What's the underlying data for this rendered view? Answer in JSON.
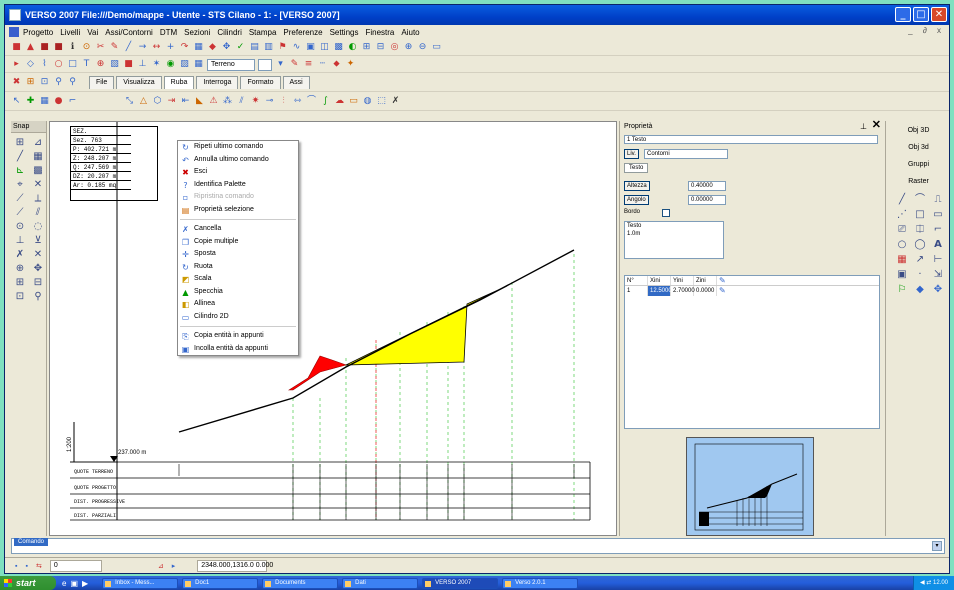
{
  "window": {
    "title": "VERSO 2007 File:///Demo/mappe - Utente - STS Cilano - 1: - [VERSO 2007]",
    "mdi_controls": "_ ∂ x"
  },
  "menu": [
    "Progetto",
    "Livelli",
    "Vai",
    "Assi/Contorni",
    "DTM",
    "Sezioni",
    "Cilindri",
    "Stampa",
    "Preferenze",
    "Settings",
    "Finestra",
    "Aiuto"
  ],
  "toolbar": {
    "layer_combo": "Terreno",
    "tabs": [
      "File",
      "Visualizza",
      "Ruba",
      "Interroga",
      "Formato",
      "Assi"
    ]
  },
  "left_panel": {
    "title": "Snap"
  },
  "info_box": {
    "lines": [
      "SEZ.",
      "Sez. 763",
      "P: 402.721 m",
      "Z: 248.207 m",
      "Q: 247.569 m",
      "DZ: 20.207 m",
      "Ar: 0.185 mq"
    ]
  },
  "drawing": {
    "ruler_label": "1:200",
    "ref_label": "237.000 m",
    "table_rows": [
      "QUOTE TERRENO",
      "QUOTE PROGETTO",
      "DIST. PROGRESSIVE",
      "DIST. PARZIALI"
    ]
  },
  "context_menu": {
    "items": [
      {
        "label": "Ripeti ultimo comando",
        "icon": "repeat-icon",
        "glyph": "↻",
        "disabled": false
      },
      {
        "label": "Annulla ultimo comando",
        "icon": "undo-icon",
        "glyph": "↶",
        "disabled": false
      },
      {
        "label": "Esci",
        "icon": "exit-icon",
        "glyph": "✖",
        "disabled": false
      },
      {
        "label": "Identifica Palette",
        "icon": "identify-icon",
        "glyph": "?",
        "disabled": false
      },
      {
        "label": "Ripristina comando",
        "icon": "restore-icon",
        "glyph": "▫",
        "disabled": true
      },
      {
        "label": "Proprietà selezione",
        "icon": "properties-icon",
        "glyph": "▤",
        "disabled": false
      },
      {
        "sep": true
      },
      {
        "label": "Cancella",
        "icon": "delete-icon",
        "glyph": "✗",
        "disabled": false
      },
      {
        "label": "Copie multiple",
        "icon": "copy-icon",
        "glyph": "❐",
        "disabled": false
      },
      {
        "label": "Sposta",
        "icon": "move-icon",
        "glyph": "✛",
        "disabled": false
      },
      {
        "label": "Ruota",
        "icon": "rotate-icon",
        "glyph": "↻",
        "disabled": false
      },
      {
        "label": "Scala",
        "icon": "scale-icon",
        "glyph": "◩",
        "disabled": false
      },
      {
        "label": "Specchia",
        "icon": "mirror-icon",
        "glyph": "▲",
        "disabled": false
      },
      {
        "label": "Allinea",
        "icon": "align-icon",
        "glyph": "◧",
        "disabled": false
      },
      {
        "label": "Cilindro 2D",
        "icon": "cylinder-icon",
        "glyph": "▭",
        "disabled": false
      },
      {
        "sep": true
      },
      {
        "label": "Copia entità in appunti",
        "icon": "clipboard-copy-icon",
        "glyph": "⎘",
        "disabled": false
      },
      {
        "label": "Incolla entità da appunti",
        "icon": "clipboard-paste-icon",
        "glyph": "▣",
        "disabled": false
      }
    ]
  },
  "properties": {
    "title": "Proprietà",
    "object": "1 Testo",
    "layer_label": "Liv.",
    "layer_value": "Contorni",
    "tab": "Testo",
    "btn_altezza": "Altezza",
    "btn_angolo": "Angolo",
    "altezza": "0.40000",
    "angolo": "0.00000",
    "check_label": "Bordo",
    "text_label": "Testo",
    "text_value": "1.0m",
    "vertex_headers": [
      "N°",
      "Xini",
      "Yini",
      "Zini"
    ],
    "vertex_row": [
      "1",
      "12.50000",
      "2.70000",
      "0.0000"
    ]
  },
  "right_panel": {
    "buttons": [
      "Obj 3D",
      "Obj 3d",
      "Gruppi",
      "Raster"
    ]
  },
  "command": {
    "tab": "Comando"
  },
  "status": {
    "layer": "0",
    "coords": "2348.000,1316.0 0.000"
  },
  "taskbar": {
    "start": "start",
    "tasks": [
      {
        "label": "Inbox - Mess...",
        "active": false
      },
      {
        "label": "Doc1",
        "active": false
      },
      {
        "label": "Documents",
        "active": false
      },
      {
        "label": "Dati",
        "active": false
      },
      {
        "label": "VERSO 2007",
        "active": true
      },
      {
        "label": "Verso 2.0.1",
        "active": false
      }
    ],
    "clock": "12.00"
  },
  "colors": {
    "cut_fill": "#ff0000",
    "fill_area": "#ffff00",
    "guide_lines": "#5fcf5f",
    "accent": "#316ac5"
  }
}
